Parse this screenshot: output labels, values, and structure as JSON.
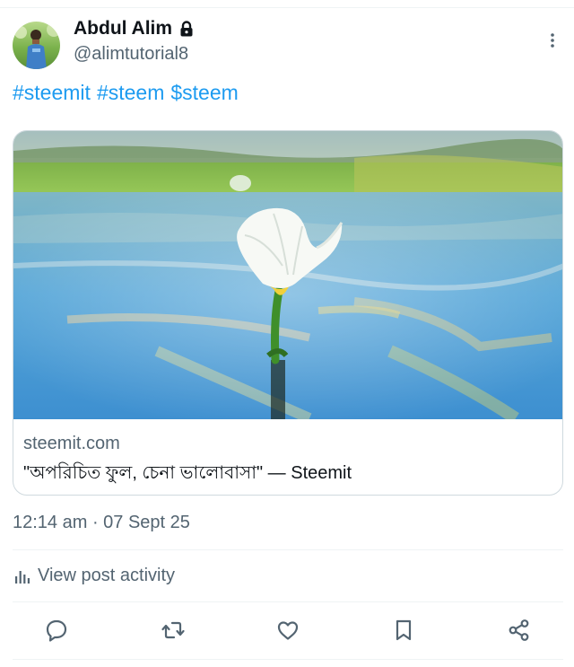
{
  "author": {
    "display_name": "Abdul Alim",
    "handle": "@alimtutorial8",
    "protected_icon": "lock-icon",
    "avatar_icon": "user-avatar"
  },
  "post": {
    "hashtags": [
      "#steemit",
      "#steem",
      "$steem"
    ],
    "link_card": {
      "domain": "steemit.com",
      "title": "\"অপরিচিত ফুল, চেনা ভালোবাসা\" — Steemit",
      "image_subject": "white water flower"
    },
    "timestamp": "12:14 am · 07 Sept 25",
    "activity_label": "View post activity"
  },
  "actions": [
    "reply-icon",
    "repost-icon",
    "like-icon",
    "bookmark-icon",
    "share-icon"
  ],
  "colors": {
    "accent": "#1d9bf0",
    "text_primary": "#0f1419",
    "text_secondary": "#536471",
    "border": "#cfd9de"
  }
}
